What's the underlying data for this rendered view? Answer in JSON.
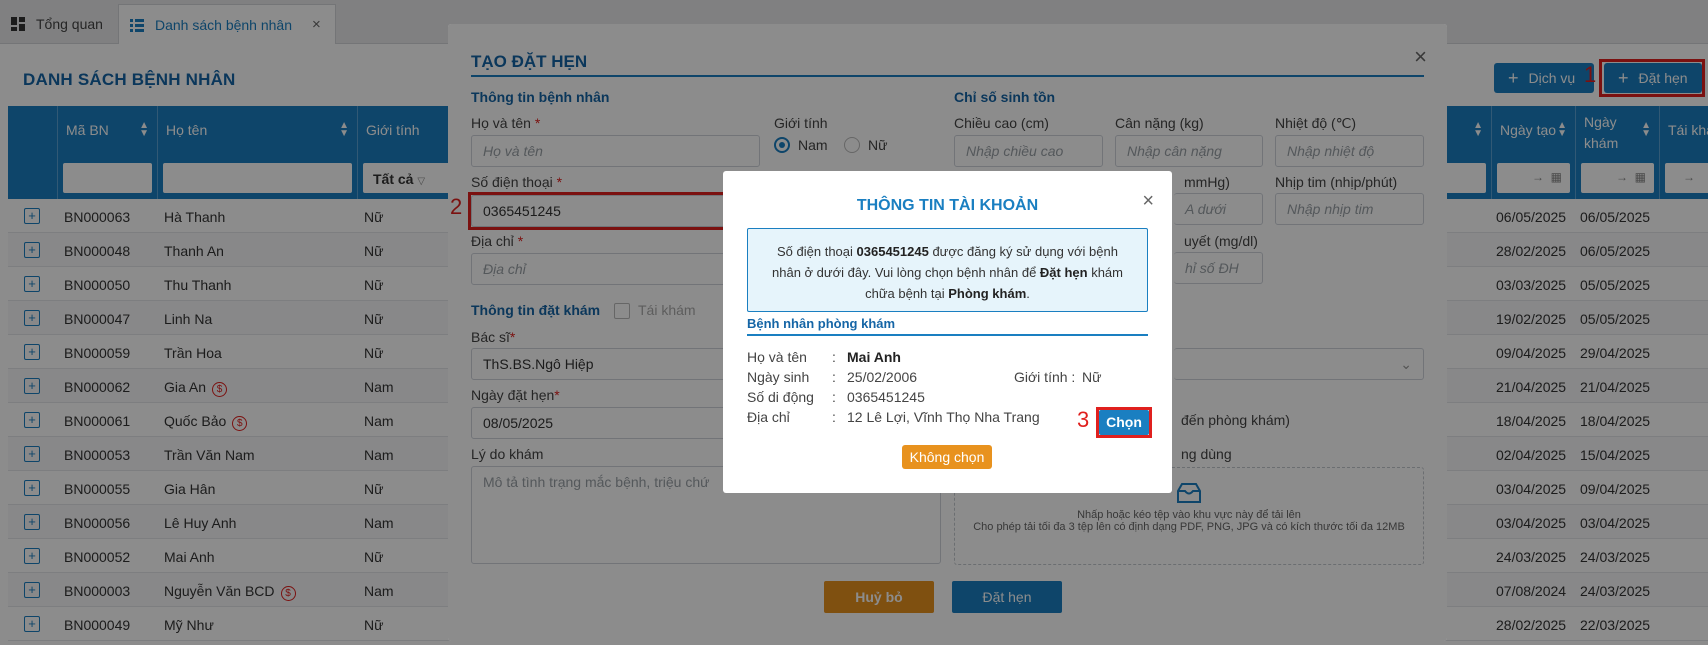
{
  "tabs": [
    {
      "label": "Tổng quan",
      "icon": "dashboard-icon"
    },
    {
      "label": "Danh sách bệnh nhân",
      "icon": "list-icon",
      "close": "×"
    }
  ],
  "page": {
    "title": "DANH SÁCH BỆNH NHÂN",
    "service_button": "Dịch vụ",
    "booking_button": "Đặt hẹn",
    "step_marker": "1"
  },
  "table": {
    "headers": {
      "id": "Mã BN",
      "name": "Họ tên",
      "gender": "Giới tính",
      "created": "Ngày tạo",
      "visit": "Ngày khám",
      "re_exam": "Tái khá"
    },
    "gender_filter": "Tất cả",
    "date_range_arrow": "→",
    "rows": [
      {
        "id": "BN000063",
        "name": "Hà Thanh",
        "gender": "Nữ",
        "created": "06/05/2025",
        "visit": "06/05/2025",
        "coin": false
      },
      {
        "id": "BN000048",
        "name": "Thanh An",
        "gender": "Nữ",
        "created": "28/02/2025",
        "visit": "06/05/2025",
        "coin": false
      },
      {
        "id": "BN000050",
        "name": "Thu Thanh",
        "gender": "Nữ",
        "created": "03/03/2025",
        "visit": "05/05/2025",
        "coin": false
      },
      {
        "id": "BN000047",
        "name": "Linh Na",
        "gender": "Nữ",
        "created": "19/02/2025",
        "visit": "05/05/2025",
        "coin": false
      },
      {
        "id": "BN000059",
        "name": "Trần Hoa",
        "gender": "Nữ",
        "created": "09/04/2025",
        "visit": "29/04/2025",
        "coin": false
      },
      {
        "id": "BN000062",
        "name": "Gia An",
        "gender": "Nam",
        "created": "21/04/2025",
        "visit": "21/04/2025",
        "coin": true
      },
      {
        "id": "BN000061",
        "name": "Quốc Bảo",
        "gender": "Nam",
        "created": "18/04/2025",
        "visit": "18/04/2025",
        "coin": true
      },
      {
        "id": "BN000053",
        "name": "Trần Văn Nam",
        "gender": "Nam",
        "created": "02/04/2025",
        "visit": "15/04/2025",
        "coin": false
      },
      {
        "id": "BN000055",
        "name": "Gia Hân",
        "gender": "Nữ",
        "created": "03/04/2025",
        "visit": "09/04/2025",
        "coin": false
      },
      {
        "id": "BN000056",
        "name": "Lê Huy Anh",
        "gender": "Nam",
        "created": "03/04/2025",
        "visit": "03/04/2025",
        "coin": false
      },
      {
        "id": "BN000052",
        "name": "Mai Anh",
        "gender": "Nữ",
        "created": "24/03/2025",
        "visit": "24/03/2025",
        "coin": false
      },
      {
        "id": "BN000003",
        "name": "Nguyễn Văn BCD",
        "gender": "Nam",
        "created": "07/08/2024",
        "visit": "24/03/2025",
        "coin": true
      },
      {
        "id": "BN000049",
        "name": "Mỹ Như",
        "gender": "Nữ",
        "created": "28/02/2025",
        "visit": "22/03/2025",
        "coin": false
      }
    ]
  },
  "booking_modal": {
    "title": "TẠO ĐẶT HẸN",
    "patient_section": "Thông tin bệnh nhân",
    "vitals_section": "Chỉ số sinh tồn",
    "name_label": "Họ và tên",
    "name_placeholder": "Họ và tên",
    "gender_label": "Giới tính",
    "gender_male": "Nam",
    "gender_female": "Nữ",
    "phone_label": "Số điện thoại",
    "phone_value": "0365451245",
    "step_marker": "2",
    "address_label": "Địa chỉ",
    "address_placeholder": "Địa chỉ",
    "booking_section": "Thông tin đặt khám",
    "re_exam_label": "Tái khám",
    "doctor_label": "Bác sĩ",
    "doctor_value": "ThS.BS.Ngô Hiệp",
    "date_label": "Ngày đặt hẹn",
    "date_value": "08/05/2025",
    "reason_label": "Lý do khám",
    "reason_placeholder": "Mô tả tình trạng mắc bệnh, triệu chứ",
    "height_label": "Chiều cao (cm)",
    "height_placeholder": "Nhập chiều cao",
    "weight_label": "Cân nặng (kg)",
    "weight_placeholder": "Nhập cân nặng",
    "temp_label": "Nhiệt độ (℃)",
    "temp_placeholder": "Nhập nhiệt độ",
    "bp_label_partial": "mmHg)",
    "bp_placeholder_partial": "A dưới",
    "pulse_label": "Nhịp tim (nhịp/phút)",
    "pulse_placeholder": "Nhập nhịp tim",
    "sugar_label_partial": "uyết (mg/dl)",
    "sugar_placeholder_partial": "hỉ số ĐH",
    "clinic_text_partial": "đến phòng khám)",
    "usage_text_partial": "ng dùng",
    "upload_line1": "Nhấp hoặc kéo tệp vào khu vực này để tải lên",
    "upload_line2": "Cho phép tải tối đa 3 tệp lên có định dạng PDF, PNG, JPG và có kích thước tối đa 12MB",
    "cancel_button": "Huỷ bỏ",
    "submit_button": "Đặt hẹn"
  },
  "account_dialog": {
    "title": "THÔNG TIN TÀI KHOẢN",
    "info_prefix": "Số điện thoại ",
    "info_phone": "0365451245",
    "info_mid1": " được đăng ký sử dụng với bệnh nhân ở dưới đây. Vui lòng chọn bệnh nhân để ",
    "info_action": "Đặt hẹn",
    "info_mid2": " khám chữa bệnh tại ",
    "info_place": "Phòng khám",
    "info_end": ".",
    "section": "Bệnh nhân phòng khám",
    "name_label": "Họ và tên",
    "name_value": "Mai Anh",
    "dob_label": "Ngày sinh",
    "dob_value": "25/02/2006",
    "gender_label": "Giới tính :",
    "gender_value": "Nữ",
    "mobile_label": "Số di động",
    "mobile_value": "0365451245",
    "address_label": "Địa chỉ",
    "address_value": "12 Lê Lợi, Vĩnh Thọ Nha Trang",
    "colon": ":",
    "step_marker": "3",
    "choose_button": "Chọn",
    "skip_button": "Không chọn"
  },
  "colors": {
    "primary": "#1a7fc1",
    "accent": "#e8921e",
    "highlight": "#e0201e"
  }
}
